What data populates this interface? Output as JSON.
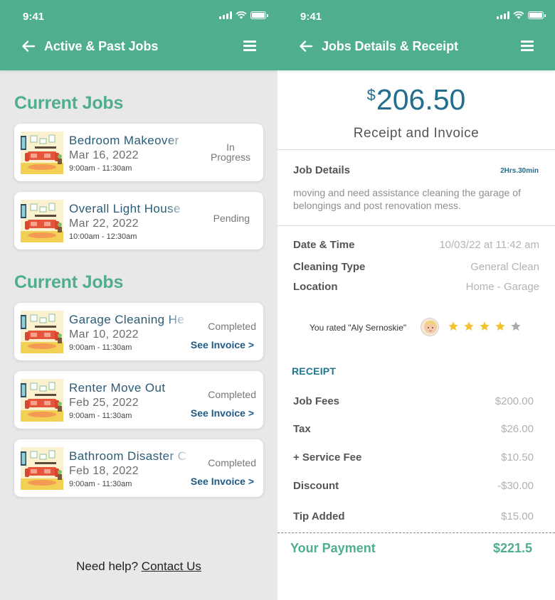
{
  "status_bar": {
    "time": "9:41"
  },
  "jobs_screen": {
    "title": "Active & Past Jobs",
    "sections": [
      {
        "title": "Current Jobs",
        "jobs": [
          {
            "name": "Bedroom Makeover",
            "date": "Mar 16, 2022",
            "time": "9:00am - 11:30am",
            "status": [
              "In",
              "Progress"
            ]
          },
          {
            "name": "Overall Light House",
            "date": "Mar 22, 2022",
            "time": "10:00am - 12:30am",
            "status": [
              "Pending"
            ]
          }
        ]
      },
      {
        "title": "Current Jobs",
        "jobs": [
          {
            "name": "Garage Cleaning He",
            "date": "Mar 10, 2022",
            "time": "9:00am - 11:30am",
            "status": [
              "Completed"
            ],
            "link": "See Invoice >"
          },
          {
            "name": "Renter Move Out",
            "date": "Feb 25, 2022",
            "time": "9:00am - 11:30am",
            "status": [
              "Completed"
            ],
            "link": "See Invoice >"
          },
          {
            "name": "Bathroom Disaster C",
            "date": "Feb 18, 2022",
            "time": "9:00am - 11:30am",
            "status": [
              "Completed"
            ],
            "link": "See Invoice >"
          }
        ]
      }
    ],
    "help_text": "Need help?",
    "help_link": "Contact Us"
  },
  "receipt_screen": {
    "title": "Jobs Details & Receipt",
    "amount_symbol": "$",
    "amount": "206.50",
    "receipt_title": "Receipt and Invoice",
    "details_label": "Job Details",
    "duration": "2Hrs.30min",
    "description": "moving and need assistance cleaning the garage of belongings and post renovation mess.",
    "info": [
      {
        "label": "Date & Time",
        "value": "10/03/22 at 11:42 am"
      },
      {
        "label": "Cleaning Type",
        "value": "General Clean"
      },
      {
        "label": "Location",
        "value": "Home - Garage"
      }
    ],
    "rated_text": "You rated \"Aly Sernoskie\"",
    "rating": 4,
    "rating_max": 5,
    "receipt_label": "RECEIPT",
    "fees": [
      {
        "label": "Job Fees",
        "value": "$200.00"
      },
      {
        "label": "Tax",
        "value": "$26.00"
      },
      {
        "label": "+ Service Fee",
        "value": "$10.50"
      },
      {
        "label": "Discount",
        "value": "-$30.00"
      },
      {
        "label": "Tip Added",
        "value": "$15.00"
      }
    ],
    "payment_label": "Your Payment",
    "payment_value": "$221.5"
  },
  "colors": {
    "header": "#4fae8d",
    "accent_green": "#4fae8d",
    "navy_text": "#2a5b77",
    "amount_blue": "#236d8e",
    "star_gold": "#f2c12e",
    "star_grey": "#a9a9a9"
  },
  "icons": {
    "back": "arrow-left-icon",
    "menu": "hamburger-menu-icon",
    "signal": "cellular-signal-icon",
    "wifi": "wifi-icon",
    "battery": "battery-icon",
    "star": "star-icon"
  }
}
